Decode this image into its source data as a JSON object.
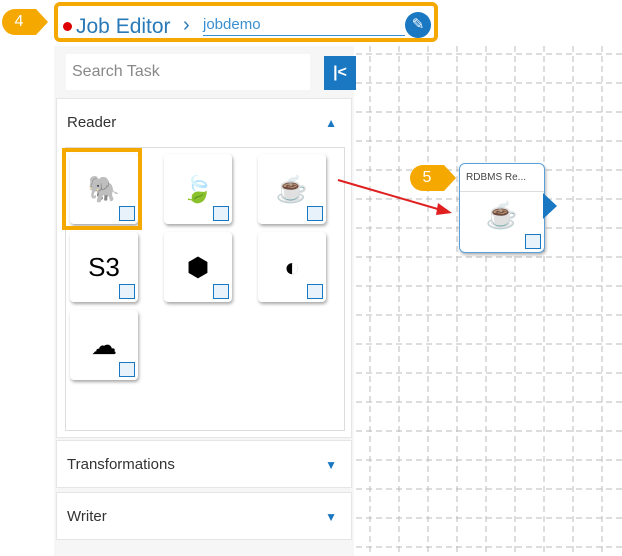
{
  "header": {
    "title": "Job Editor",
    "job_name": "jobdemo"
  },
  "callouts": [
    "4",
    "5"
  ],
  "search": {
    "placeholder": "Search Task"
  },
  "sections": [
    {
      "label": "Reader",
      "expanded": true
    },
    {
      "label": "Transformations",
      "expanded": false
    },
    {
      "label": "Writer",
      "expanded": false
    }
  ],
  "readers": [
    {
      "icon": "hadoop-icon",
      "g": "🐘"
    },
    {
      "icon": "mongodb-icon",
      "g": "🍃"
    },
    {
      "icon": "java-rdbms-icon",
      "g": "☕"
    },
    {
      "icon": "s3-icon",
      "g": "S3"
    },
    {
      "icon": "binary-file-icon",
      "g": "⬢"
    },
    {
      "icon": "elastic-icon",
      "g": "◐"
    },
    {
      "icon": "cloud-icon",
      "g": "☁"
    }
  ],
  "node": {
    "title": "RDBMS Re..."
  },
  "colors": {
    "accent": "#1a78c2",
    "callout": "#f5a800"
  }
}
